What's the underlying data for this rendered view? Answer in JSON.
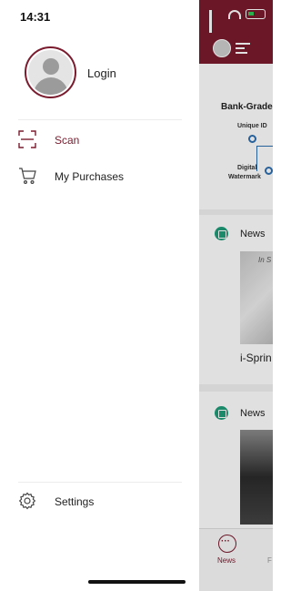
{
  "status_bar": {
    "time": "14:31"
  },
  "drawer": {
    "profile": {
      "login_label": "Login"
    },
    "menu": [
      {
        "label": "Scan",
        "icon": "scan-icon",
        "active": true
      },
      {
        "label": "My Purchases",
        "icon": "cart-icon",
        "active": false
      }
    ],
    "footer": {
      "settings_label": "Settings",
      "icon": "gear-icon"
    }
  },
  "background_app": {
    "banner": {
      "title": "Bank-Grade",
      "unique_id": "Unique ID",
      "watermark_line1": "Digital",
      "watermark_line2": "Watermark"
    },
    "cards": [
      {
        "label": "News",
        "image_text": "In S",
        "title": "i-Sprin"
      },
      {
        "label": "News"
      }
    ],
    "tabs": [
      {
        "label": "News",
        "active": true
      },
      {
        "label": "F",
        "active": false
      }
    ]
  },
  "colors": {
    "accent": "#7a1b2e",
    "news_badge": "#1f9e7a",
    "diagram_blue": "#2c6fb2"
  }
}
